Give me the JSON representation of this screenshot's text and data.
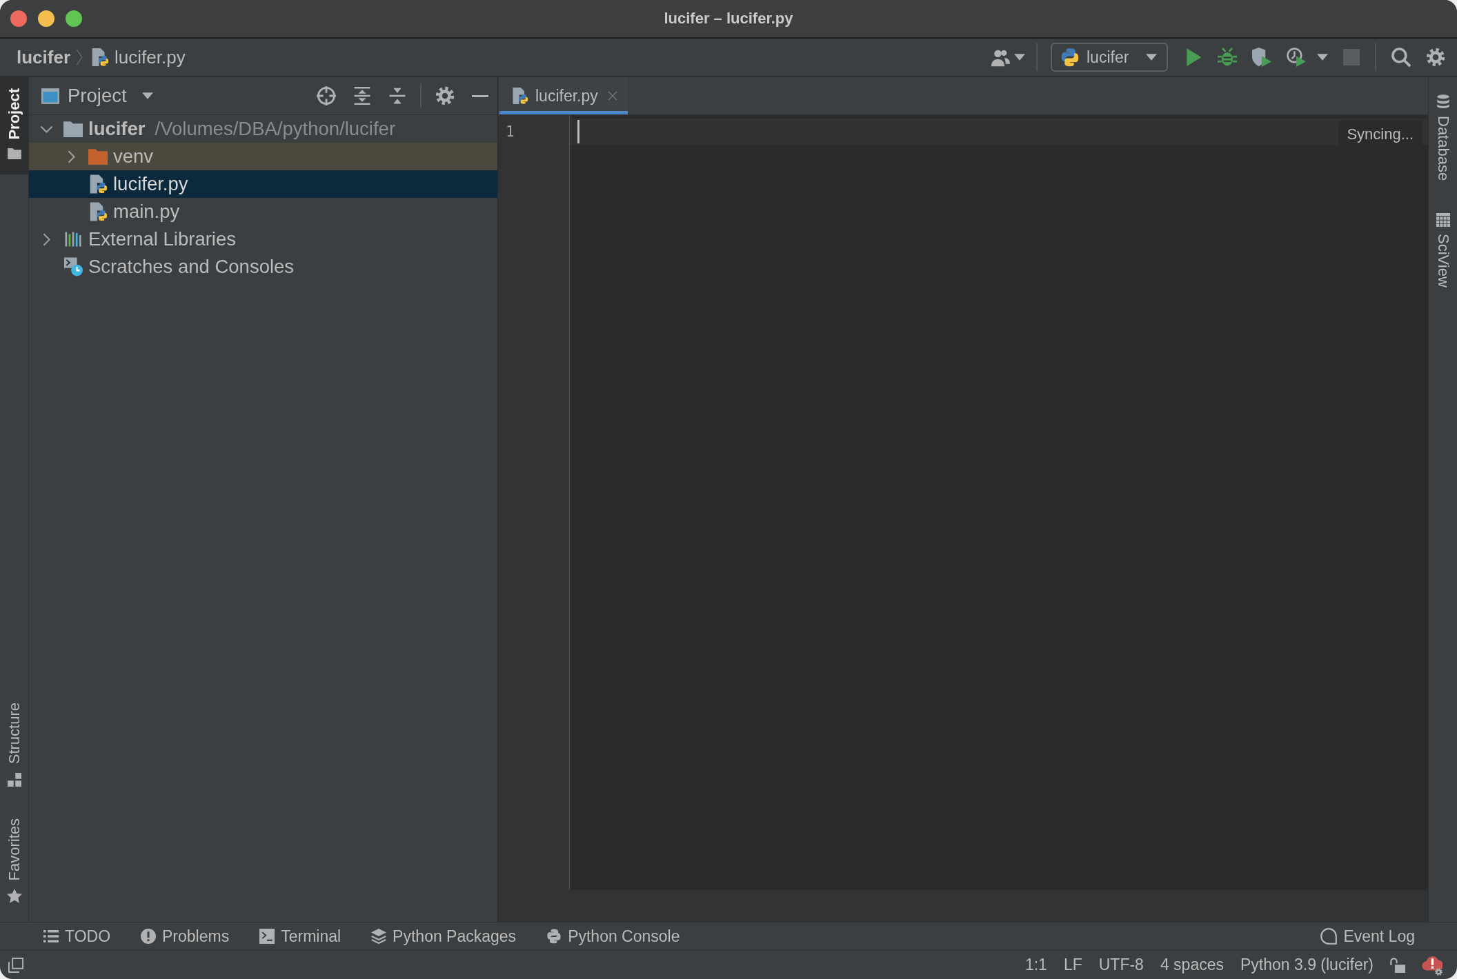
{
  "window": {
    "title": "lucifer – lucifer.py"
  },
  "navigation_bar": {
    "breadcrumbs": [
      {
        "label": "lucifer",
        "kind": "project"
      },
      {
        "label": "lucifer.py",
        "kind": "python-file"
      }
    ],
    "run_configuration": {
      "label": "lucifer"
    },
    "stop_button": {
      "disabled": true
    }
  },
  "left_stripe": {
    "top": [
      {
        "label": "Project",
        "kind": "project",
        "selected": true
      }
    ],
    "bottom": [
      {
        "label": "Structure",
        "kind": "structure",
        "selected": false
      },
      {
        "label": "Favorites",
        "kind": "favorites",
        "selected": false
      }
    ]
  },
  "project_panel": {
    "title": "Project",
    "tree": [
      {
        "label": "lucifer",
        "kind": "project-folder",
        "path": "/Volumes/DBA/python/lucifer",
        "expanded": true,
        "selected": false,
        "children": [
          {
            "label": "venv",
            "kind": "excluded-folder",
            "expanded": false,
            "selected": false
          },
          {
            "label": "lucifer.py",
            "kind": "python-file",
            "selected": true
          },
          {
            "label": "main.py",
            "kind": "python-file",
            "selected": false
          }
        ]
      },
      {
        "label": "External Libraries",
        "kind": "libraries",
        "expanded": false,
        "selected": false
      },
      {
        "label": "Scratches and Consoles",
        "kind": "scratches",
        "selected": false
      }
    ]
  },
  "editor": {
    "tabs": [
      {
        "label": "lucifer.py",
        "selected": true
      }
    ],
    "line_numbers": [
      "1"
    ],
    "notice": "Syncing..."
  },
  "right_stripe": [
    {
      "label": "Database",
      "kind": "database",
      "selected": false
    },
    {
      "label": "SciView",
      "kind": "sciview",
      "selected": false
    }
  ],
  "tool_window_bar": {
    "left": [
      {
        "label": "TODO",
        "kind": "todo"
      },
      {
        "label": "Problems",
        "kind": "problems"
      },
      {
        "label": "Terminal",
        "kind": "terminal"
      },
      {
        "label": "Python Packages",
        "kind": "packages"
      },
      {
        "label": "Python Console",
        "kind": "console"
      }
    ],
    "right": [
      {
        "label": "Event Log",
        "kind": "event-log"
      }
    ]
  },
  "status_bar": {
    "items": [
      "1:1",
      "LF",
      "UTF-8",
      "4 spaces",
      "Python 3.9 (lucifer)"
    ]
  }
}
